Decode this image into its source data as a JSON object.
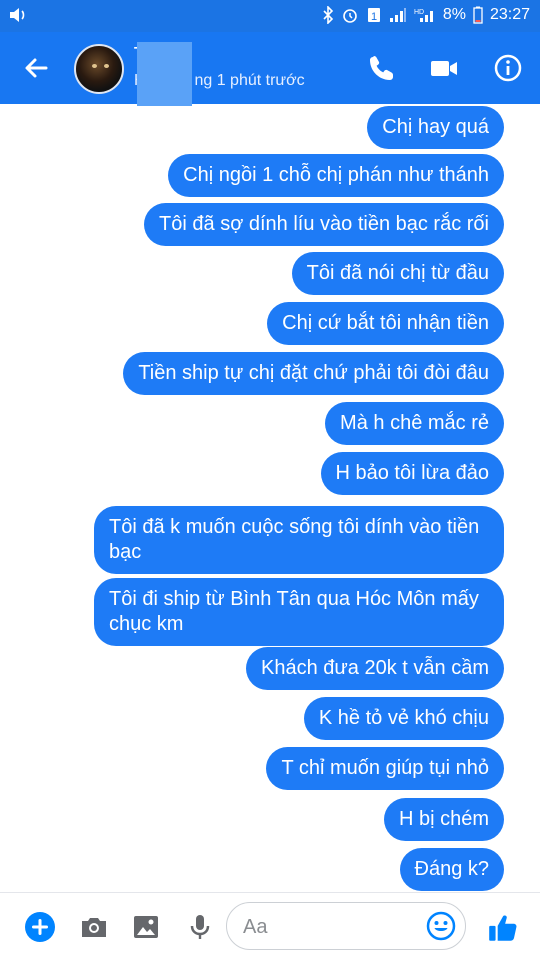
{
  "status_bar": {
    "battery_percent": "8%",
    "time": "23:27"
  },
  "header": {
    "contact_name": "T",
    "status_prefix": "H",
    "status_suffix": "ng 1 phút trước",
    "back_icon": "arrow-left-icon",
    "call_icon": "phone-icon",
    "video_icon": "video-camera-icon",
    "info_icon": "info-icon"
  },
  "messages": [
    {
      "text": "Chị hay quá"
    },
    {
      "text": "Chị ngồi 1 chỗ chị phán như thánh"
    },
    {
      "text": "Tôi đã sợ dính líu vào tiền bạc rắc rối"
    },
    {
      "text": "Tôi đã nói chị từ đầu"
    },
    {
      "text": "Chị cứ bắt tôi nhận tiền"
    },
    {
      "text": "Tiền ship tự chị đặt chứ phải tôi đòi đâu"
    },
    {
      "text": "Mà h chê mắc rẻ"
    },
    {
      "text": "H bảo tôi lừa đảo"
    },
    {
      "text": "Tôi đã k muốn cuộc sống tôi dính vào tiền bạc"
    },
    {
      "text": "Tôi đi ship từ Bình Tân qua Hóc Môn mấy chục km"
    },
    {
      "text": "Khách đưa 20k t vẫn cầm"
    },
    {
      "text": "K hề tỏ vẻ khó chịu"
    },
    {
      "text": "T chỉ muốn giúp tụi nhỏ"
    },
    {
      "text": "H bị chém"
    },
    {
      "text": "Đáng k?"
    }
  ],
  "composer": {
    "placeholder": "Aa",
    "icons": [
      "plus-icon",
      "camera-icon",
      "image-icon",
      "microphone-icon",
      "emoji-icon",
      "thumbs-up-icon"
    ]
  },
  "colors": {
    "header_bg": "#1877f2",
    "status_bg": "#1b74e4",
    "bubble_bg": "#1e7bf6",
    "accent": "#0084ff"
  }
}
